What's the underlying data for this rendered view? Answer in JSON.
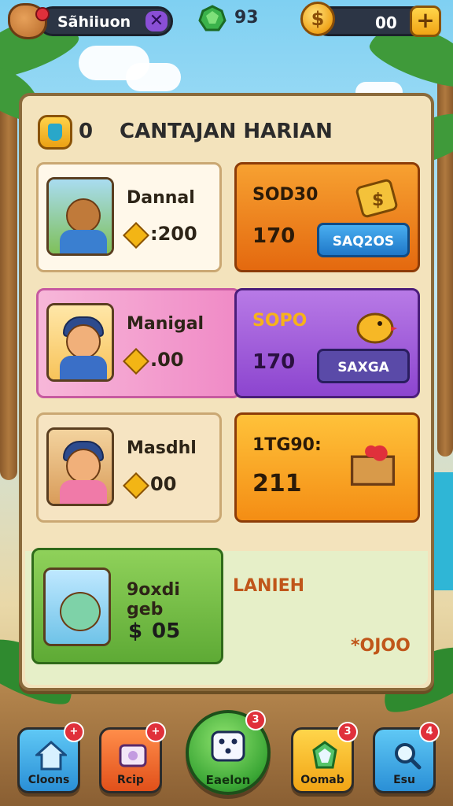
{
  "top_bar": {
    "profile_name": "Sãhiiuon",
    "close_symbol": "✕",
    "gem_count": "93",
    "coin_symbol": "$",
    "coin_count": "00",
    "plus_symbol": "+"
  },
  "panel": {
    "header_count": "0",
    "header_title": "CANTAJAN HARIAN"
  },
  "tasks": [
    {
      "name": "Dannal",
      "reward": ":200",
      "right_title": "SOD30",
      "right_value": "170",
      "right_button": "SAQ2OS"
    },
    {
      "name": "Manigal",
      "reward": ".00",
      "right_title": "SOPO",
      "right_value": "170",
      "right_button": "SAXGA"
    },
    {
      "name": "Masdhl",
      "reward": "00",
      "right_title": "1TG90:",
      "right_value": "211"
    }
  ],
  "bonus": {
    "name": "9oxdi geb",
    "reward_symbol": "$",
    "reward": "05",
    "label": "LANIEH",
    "amount": "*OJOO"
  },
  "bottom_nav": [
    {
      "label": "Cloons",
      "badge": "+"
    },
    {
      "label": "Rcip",
      "badge": "+"
    },
    {
      "label": "Eaelon",
      "badge": "3"
    },
    {
      "label": "Oomab",
      "badge": "3"
    },
    {
      "label": "Esu",
      "badge": "4"
    }
  ],
  "colors": {
    "orange_card": "#f08a18",
    "purple_card": "#9a55d8",
    "yellow_card": "#f8a91b",
    "green_card": "#7ec24b",
    "blue_button": "#2f8fd8"
  }
}
